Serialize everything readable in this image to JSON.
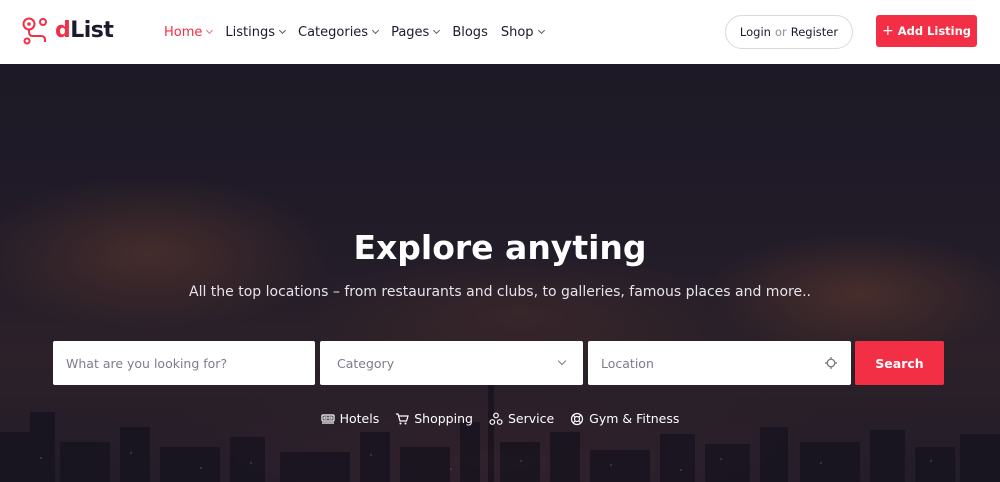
{
  "brand": {
    "name_first": "d",
    "name_rest": "List",
    "accent": "#f22f45"
  },
  "nav": {
    "items": [
      {
        "label": "Home",
        "active": true,
        "dropdown": true
      },
      {
        "label": "Listings",
        "dropdown": true
      },
      {
        "label": "Categories",
        "dropdown": true
      },
      {
        "label": "Pages",
        "dropdown": true
      },
      {
        "label": "Blogs",
        "dropdown": false
      },
      {
        "label": "Shop",
        "dropdown": true
      }
    ]
  },
  "auth": {
    "login": "Login",
    "or": "or",
    "register": "Register"
  },
  "add_listing": {
    "icon": "plus-icon",
    "label": "Add Listing"
  },
  "hero": {
    "title": "Explore anyting",
    "subtitle": "All the top locations – from restaurants and clubs, to galleries, famous places and more.."
  },
  "search": {
    "keyword_placeholder": "What are you looking for?",
    "category_label": "Category",
    "location_placeholder": "Location",
    "button": "Search"
  },
  "quick_links": [
    {
      "label": "Hotels",
      "icon": "bed-icon"
    },
    {
      "label": "Shopping",
      "icon": "cart-icon"
    },
    {
      "label": "Service",
      "icon": "service-icon"
    },
    {
      "label": "Gym & Fitness",
      "icon": "lifebuoy-icon"
    }
  ]
}
